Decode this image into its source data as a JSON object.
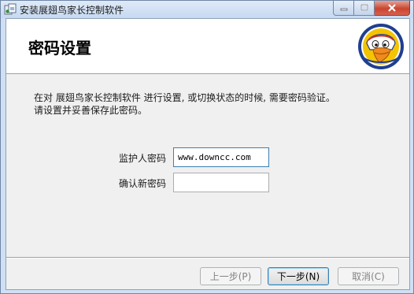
{
  "window": {
    "title": "安装展翅鸟家长控制软件",
    "controls": {
      "minimize": "minimize",
      "maximize": "maximize",
      "close": "close"
    }
  },
  "header": {
    "title": "密码设置",
    "logo_icon": "eagle-mascot-logo"
  },
  "description": {
    "line1": "在对 展翅鸟家长控制软件 进行设置, 或切换状态的时候, 需要密码验证。",
    "line2": "请设置并妥善保存此密码。"
  },
  "form": {
    "guardian_password": {
      "label": "监护人密码",
      "value": "www.downcc.com"
    },
    "confirm_password": {
      "label": "确认新密码",
      "value": ""
    }
  },
  "buttons": {
    "back": "上一步(P)",
    "next": "下一步(N)",
    "cancel": "取消(C)"
  },
  "colors": {
    "window_frame": "#cfe0f4",
    "header_bg": "#ffffff",
    "body_bg": "#f0f0f0",
    "close_button": "#c9462f",
    "logo_blue": "#1f3f8f",
    "logo_yellow": "#f5c400"
  }
}
